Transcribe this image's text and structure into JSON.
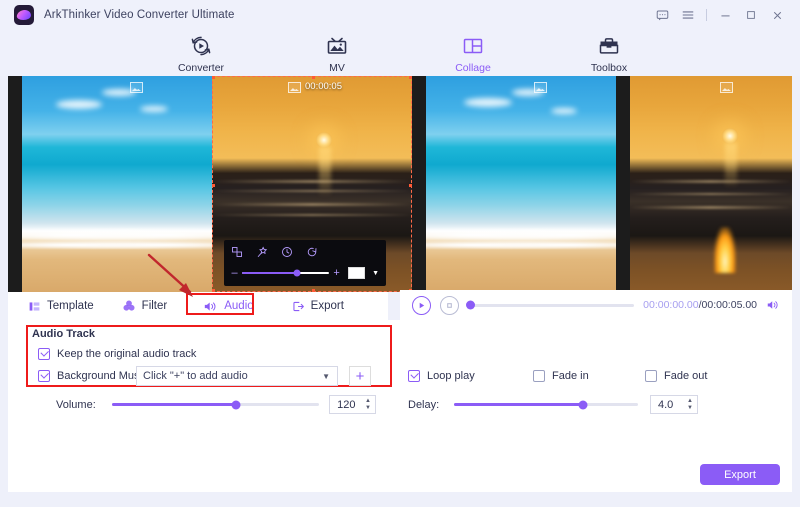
{
  "window": {
    "app_title": "ArkThinker Video Converter Ultimate",
    "controls": [
      {
        "name": "feedback",
        "glyph": "feedback-icon"
      },
      {
        "name": "menu",
        "glyph": "hamburger-icon"
      },
      {
        "name": "minimize",
        "glyph": "minimize-icon"
      },
      {
        "name": "maximize",
        "glyph": "maximize-icon"
      },
      {
        "name": "close",
        "glyph": "close-icon"
      }
    ]
  },
  "nav": {
    "items": [
      {
        "label": "Converter",
        "icon": "converter-icon",
        "active": false
      },
      {
        "label": "MV",
        "icon": "mv-icon",
        "active": false
      },
      {
        "label": "Collage",
        "icon": "collage-icon",
        "active": true
      },
      {
        "label": "Toolbox",
        "icon": "toolbox-icon",
        "active": false
      }
    ],
    "active_color": "#8b5cf6"
  },
  "preview": {
    "cells": [
      {
        "name": "cell-1",
        "scene": "beach",
        "badge_icon": "image-icon",
        "duration": ""
      },
      {
        "name": "cell-2",
        "scene": "sunset",
        "badge_icon": "image-icon",
        "duration": "00:00:05",
        "selected": true
      },
      {
        "name": "cell-3",
        "scene": "beach",
        "badge_icon": "image-icon",
        "duration": ""
      },
      {
        "name": "cell-4",
        "scene": "sunset-fire",
        "badge_icon": "image-icon",
        "duration": ""
      }
    ],
    "overlay_toolbar": {
      "icons": [
        "crop-icon",
        "magic-wand-icon",
        "clock-icon",
        "rotate-icon"
      ],
      "zoom_minus": "–",
      "zoom_plus": "+",
      "ratio_caret": "▼"
    },
    "selection_color": "#ff5a36"
  },
  "tabs": [
    {
      "label": "Template",
      "icon": "template-icon",
      "active": false
    },
    {
      "label": "Filter",
      "icon": "filter-icon",
      "active": false
    },
    {
      "label": "Audio",
      "icon": "audio-icon",
      "active": true,
      "highlighted": true
    },
    {
      "label": "Export",
      "icon": "export-icon",
      "active": false
    }
  ],
  "player": {
    "play_icon": "play-icon",
    "stop_icon": "stop-icon",
    "current_time": "00:00:00.00",
    "separator": "/",
    "total_time": "00:00:05.00",
    "volume_icon": "volume-icon",
    "progress_percent": 0
  },
  "audio_track": {
    "group_title": "Audio Track",
    "keep_original": {
      "label": "Keep the original audio track",
      "checked": true
    },
    "background_music": {
      "label": "Background Music",
      "checked": true
    },
    "music_select": {
      "value": "Click \"+\" to add audio",
      "caret": "▼"
    },
    "add_button": "+",
    "volume": {
      "label": "Volume:",
      "value": "120",
      "percent": 60
    },
    "loop_play": {
      "label": "Loop play",
      "checked": true
    },
    "fade_in": {
      "label": "Fade in",
      "checked": false
    },
    "fade_out": {
      "label": "Fade out",
      "checked": false
    },
    "delay": {
      "label": "Delay:",
      "value": "4.0",
      "percent": 70
    }
  },
  "footer": {
    "export_label": "Export"
  },
  "annotation": {
    "arrow_color": "#c1272d",
    "highlight_color": "#ee1b1b"
  }
}
